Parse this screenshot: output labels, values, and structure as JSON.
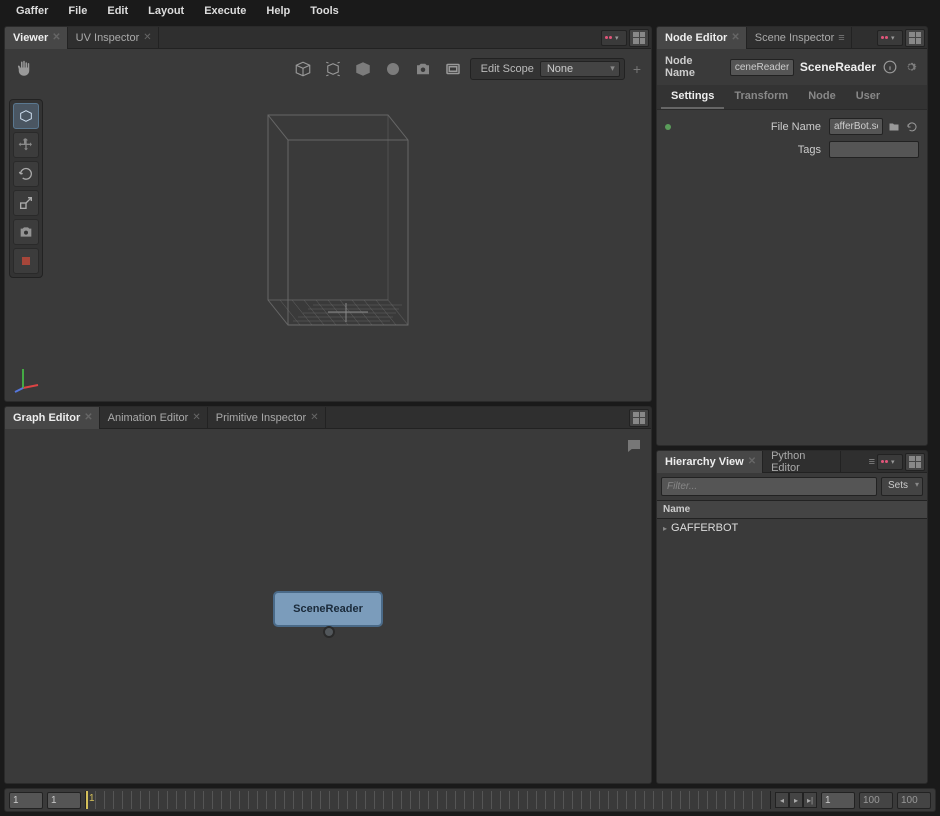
{
  "menubar": {
    "app": "Gaffer",
    "items": [
      "File",
      "Edit",
      "Layout",
      "Execute",
      "Help",
      "Tools"
    ]
  },
  "viewer": {
    "tabs": [
      {
        "label": "Viewer",
        "active": true
      },
      {
        "label": "UV Inspector",
        "active": false
      }
    ],
    "edit_scope_label": "Edit Scope",
    "edit_scope_value": "None"
  },
  "graph": {
    "tabs": [
      {
        "label": "Graph Editor",
        "active": true
      },
      {
        "label": "Animation Editor",
        "active": false
      },
      {
        "label": "Primitive Inspector",
        "active": false
      }
    ],
    "node_label": "SceneReader"
  },
  "node_editor": {
    "tabs": [
      {
        "label": "Node Editor",
        "active": true
      },
      {
        "label": "Scene Inspector",
        "active": false
      }
    ],
    "node_name_label": "Node Name",
    "node_name_value": "ceneReader",
    "node_type": "SceneReader",
    "subtabs": [
      {
        "label": "Settings",
        "active": true
      },
      {
        "label": "Transform",
        "active": false
      },
      {
        "label": "Node",
        "active": false
      },
      {
        "label": "User",
        "active": false
      }
    ],
    "file_name_label": "File Name",
    "file_name_value": "afferBot.scc",
    "tags_label": "Tags",
    "tags_value": ""
  },
  "hierarchy": {
    "tabs": [
      {
        "label": "Hierarchy View",
        "active": true
      },
      {
        "label": "Python Editor",
        "active": false
      }
    ],
    "filter_placeholder": "Filter...",
    "sets_label": "Sets",
    "col_name": "Name",
    "items": [
      "GAFFERBOT"
    ]
  },
  "timeline": {
    "start": "1",
    "in": "1",
    "playhead": "1",
    "current": "1",
    "out": "100",
    "end": "100"
  }
}
